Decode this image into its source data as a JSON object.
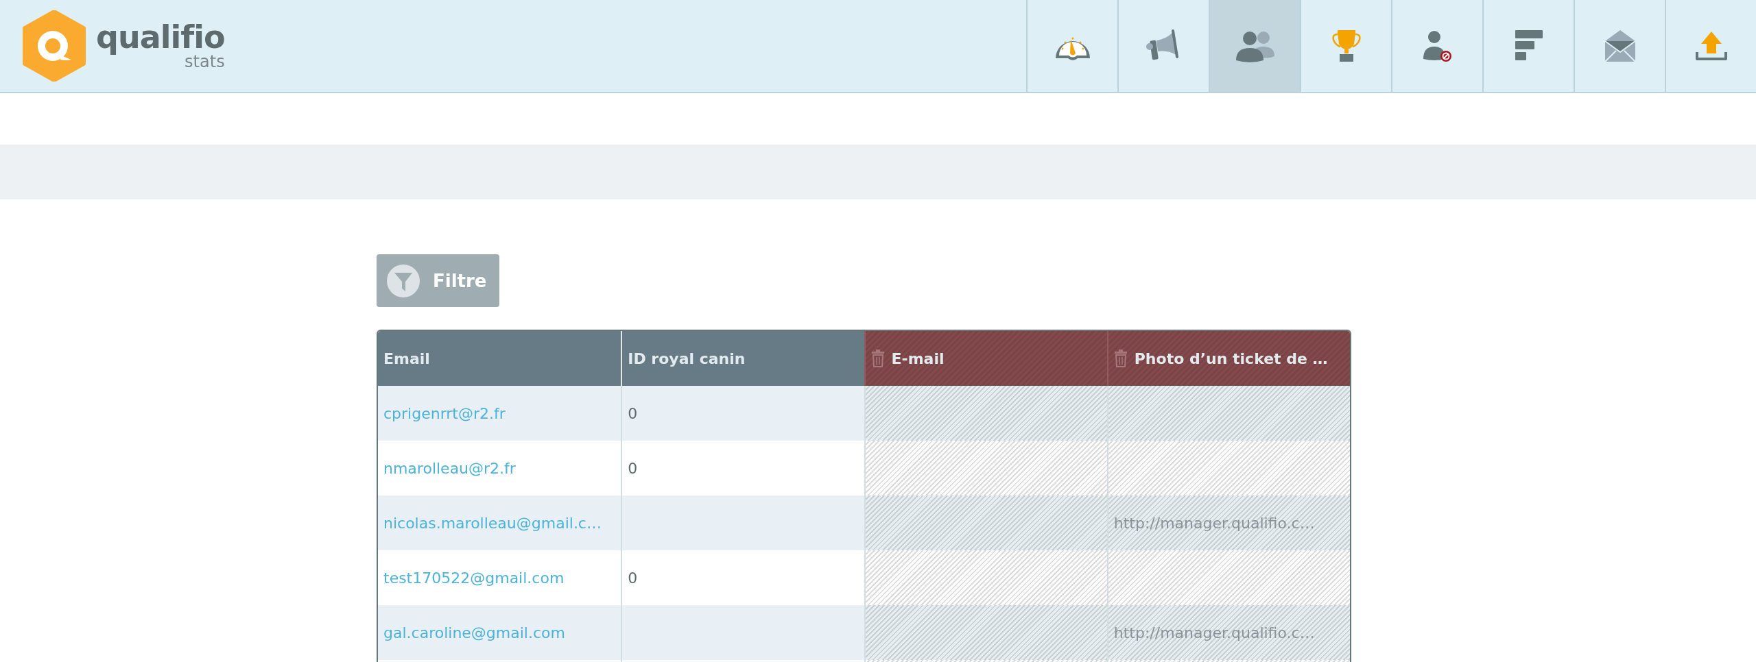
{
  "header": {
    "logo": {
      "name": "qualifio",
      "subtitle": "stats"
    },
    "nav": [
      {
        "kind": "gauge",
        "selected": false
      },
      {
        "kind": "megaphone",
        "selected": false
      },
      {
        "kind": "users",
        "selected": true
      },
      {
        "kind": "trophy",
        "selected": false
      },
      {
        "kind": "blocked-user",
        "selected": false
      },
      {
        "kind": "bars",
        "selected": false
      },
      {
        "kind": "mail",
        "selected": false
      },
      {
        "kind": "upload",
        "selected": false
      }
    ]
  },
  "filter_button": {
    "label": "Filtre"
  },
  "table": {
    "columns": [
      {
        "label": "Email",
        "deleted": false
      },
      {
        "label": "ID royal canin",
        "deleted": false
      },
      {
        "label": "E-mail",
        "deleted": true
      },
      {
        "label": "Photo d’un ticket de …",
        "deleted": true
      }
    ],
    "rows": [
      [
        "cprigenrrt@r2.fr",
        "0",
        "",
        ""
      ],
      [
        "nmarolleau@r2.fr",
        "0",
        "",
        ""
      ],
      [
        "nicolas.marolleau@gmail.c…",
        "",
        "",
        "http://manager.qualifio.c…"
      ],
      [
        "test170522@gmail.com",
        "0",
        "",
        ""
      ],
      [
        "gal.caroline@gmail.com",
        "",
        "",
        "http://manager.qualifio.c…"
      ],
      [
        "",
        "",
        "",
        ""
      ]
    ]
  }
}
